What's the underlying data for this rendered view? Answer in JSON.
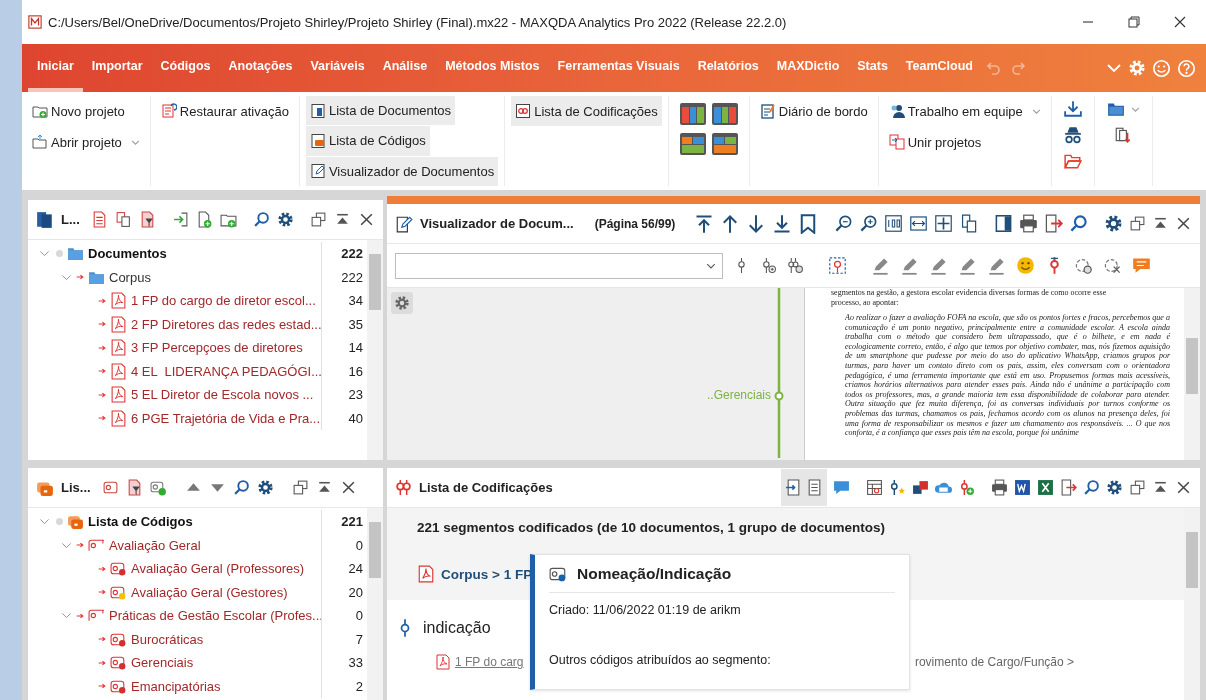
{
  "window": {
    "title": "C:/Users/Bel/OneDrive/Documentos/Projeto Shirley/Projeto Shirley (Final).mx22 - MAXQDA Analytics Pro 2022 (Release 22.2.0)"
  },
  "menu_tabs": [
    {
      "label": "Iniciar",
      "selected": true
    },
    {
      "label": "Importar",
      "selected": false
    },
    {
      "label": "Códigos",
      "selected": false
    },
    {
      "label": "Anotações",
      "selected": false
    },
    {
      "label": "Variáveis",
      "selected": false
    },
    {
      "label": "Análise",
      "selected": false
    },
    {
      "label": "Métodos Mistos",
      "selected": false
    },
    {
      "label": "Ferramentas Visuais",
      "selected": false
    },
    {
      "label": "Relatórios",
      "selected": false
    },
    {
      "label": "MAXDictio",
      "selected": false
    },
    {
      "label": "Stats",
      "selected": false
    },
    {
      "label": "TeamCloud",
      "selected": false
    }
  ],
  "ribbon_groups": [
    {
      "kind": "buttons",
      "items": [
        {
          "label": "Novo projeto",
          "on": false,
          "dropdown": false
        },
        {
          "label": "Abrir projeto",
          "on": false,
          "dropdown": true
        }
      ]
    },
    {
      "kind": "buttons",
      "items": [
        {
          "label": "Restaurar ativação",
          "on": false,
          "dropdown": false
        }
      ]
    },
    {
      "kind": "buttons",
      "items": [
        {
          "label": "Lista de Documentos",
          "on": true,
          "dropdown": false
        },
        {
          "label": "Lista de Códigos",
          "on": true,
          "dropdown": false
        },
        {
          "label": "Visualizador de Documentos",
          "on": true,
          "dropdown": false
        }
      ]
    },
    {
      "kind": "buttons",
      "items": [
        {
          "label": "Lista de Codificações",
          "on": true,
          "dropdown": false
        }
      ]
    },
    {
      "kind": "layouts"
    },
    {
      "kind": "buttons",
      "items": [
        {
          "label": "Diário de bordo",
          "on": false,
          "dropdown": false
        }
      ]
    },
    {
      "kind": "buttons",
      "items": [
        {
          "label": "Trabalho em equipe",
          "on": false,
          "dropdown": true
        },
        {
          "label": "Unir projetos",
          "on": false,
          "dropdown": false
        }
      ]
    },
    {
      "kind": "tools"
    },
    {
      "kind": "files"
    }
  ],
  "document_pane": {
    "title": "L...",
    "tree": [
      {
        "label": "Documentos",
        "count": "222",
        "kind": "root",
        "expanded": true,
        "children": [
          {
            "label": "Corpus",
            "count": "222",
            "kind": "group",
            "expanded": true,
            "children": [
              {
                "label": "1 FP do cargo de diretor escol...",
                "count": "34",
                "kind": "pdf"
              },
              {
                "label": "2 FP Diretores das redes estad...",
                "count": "35",
                "kind": "pdf"
              },
              {
                "label": "3 FP Percepçoes de diretores",
                "count": "14",
                "kind": "pdf"
              },
              {
                "label": "4 EL  LIDERANÇA PEDAGÓGI...",
                "count": "16",
                "kind": "pdf"
              },
              {
                "label": "5 EL Diretor de Escola novos ...",
                "count": "23",
                "kind": "pdf"
              },
              {
                "label": "6 PGE Trajetória de Vida e Pra...",
                "count": "40",
                "kind": "pdf"
              }
            ]
          }
        ]
      }
    ]
  },
  "code_pane": {
    "title": "Lis...",
    "tree": [
      {
        "label": "Lista de Códigos",
        "count": "221",
        "kind": "root",
        "expanded": true,
        "children": [
          {
            "label": "Avaliação Geral",
            "count": "0",
            "kind": "code",
            "expanded": true,
            "children": [
              {
                "label": "Avaliação Geral (Professores)",
                "count": "24",
                "kind": "code",
                "color": "#d32f2f"
              },
              {
                "label": "Avaliação Geral (Gestores)",
                "count": "20",
                "kind": "code",
                "color": "#f2c200"
              }
            ]
          },
          {
            "label": "Práticas de Gestão Escolar (Profes...",
            "count": "0",
            "kind": "code",
            "expanded": true,
            "children": [
              {
                "label": "Burocráticas",
                "count": "7",
                "kind": "code",
                "color": "#d32f2f"
              },
              {
                "label": "Gerenciais",
                "count": "33",
                "kind": "code",
                "color": "#d32f2f"
              },
              {
                "label": "Emancipatórias",
                "count": "2",
                "kind": "code",
                "color": "#d32f2f"
              }
            ]
          }
        ]
      }
    ]
  },
  "viewer": {
    "title": "Visualizador de Docum...",
    "page_label": "(Página 56/99)",
    "code_label": "..Gerenciais",
    "page_text": [
      {
        "kind": "body",
        "text": "segmentos na gestão, a gestora escolar evidencia diversas formas de como ocorre esse"
      },
      {
        "kind": "body",
        "text": "processo, ao apontar:"
      },
      {
        "kind": "quote",
        "text": "Ao realizar o fazer a avaliação FOFA na escola, que são os pontos fortes e fracos, percebemos que a comunicação é um ponto negativo, principalmente entre a comunidade escolar. A escola ainda trabalha com o método que considero bem ultrapassado, que é o bilhete, e em nada é ecologicamente correto, então, é algo que temos por objetivo combater, mas, nós fizemos aquisição de um smartphone que pudesse por meio do uso do aplicativo WhatsApp, criamos grupos por turmas, para haver um contato direto com os pais, assim, eles conversam com o orientadora pedagógica, é uma ferramenta importante que está em uso. Propusemos formas mais acessíveis, criamos horários alternativos para atender esses pais. Ainda não é unânime a participação com todos os professores, mas, a grande maioria tem essa disponibilidade de colaborar para atender. Outra situação que fez muita diferença, foi as conversas individuais por turnos conforme os problemas das turmas, chamamos os pais, fechamos acordo com os alunos na presença deles, foi uma forma de responsabilizar os mesmos e fazer um chamamento aos responsáveis. ... O que nos conforta, é a confiança que esses pais têm na escola, porque foi unânime"
      }
    ]
  },
  "codings": {
    "title": "Lista de Codificações",
    "summary": "221 segmentos codificados (de 10 documentos, 1 grupo de documentos)",
    "document_link": "Corpus > 1 FP",
    "segment_text": "indicação",
    "source_link": "1 FP do carg",
    "code_path": "rovimento de Cargo/Função >",
    "tooltip": {
      "title": "Nomeação/Indicação",
      "created": "Criado:  11/06/2022 01:19 de arikm",
      "other_codes": "Outros códigos atribuídos ao segmento:"
    }
  }
}
